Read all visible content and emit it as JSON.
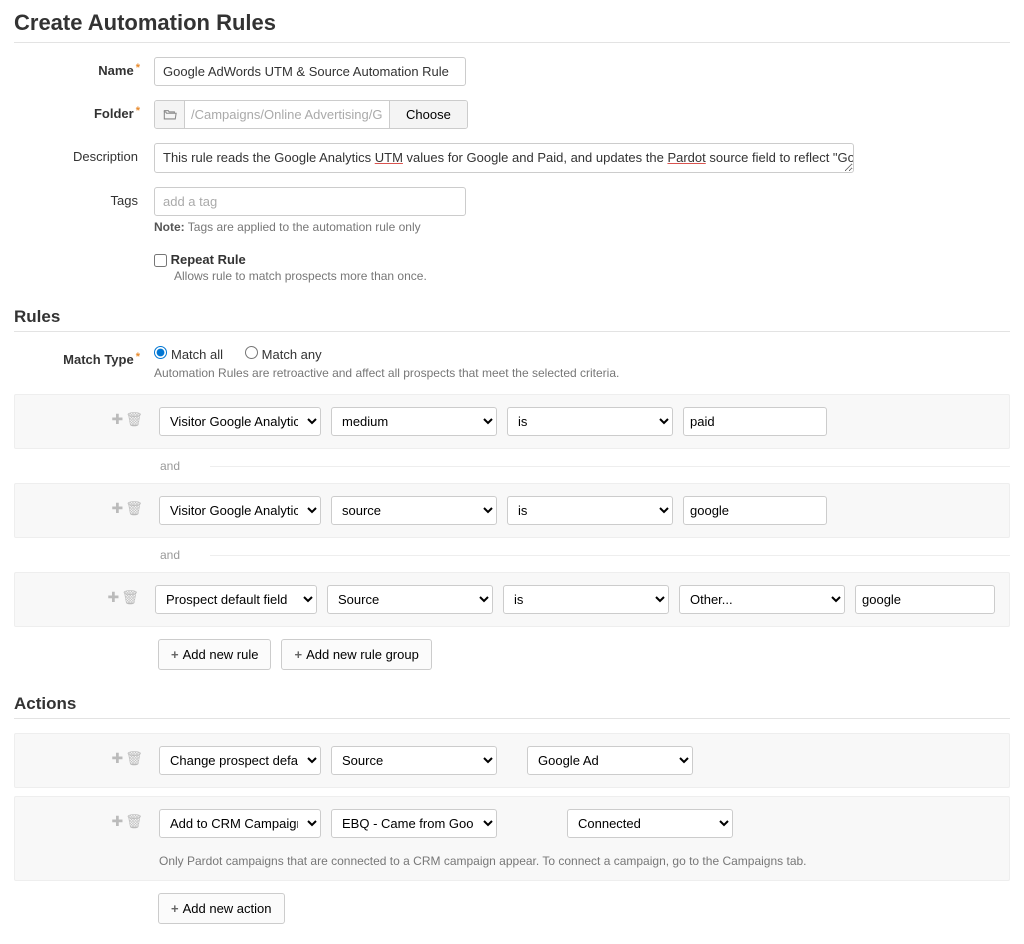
{
  "header": {
    "title": "Create Automation Rules"
  },
  "form": {
    "name_label": "Name",
    "name_value": "Google AdWords UTM & Source Automation Rule",
    "folder_label": "Folder",
    "folder_path": "/Campaigns/Online Advertising/Google Ad",
    "folder_choose": "Choose",
    "description_label": "Description",
    "description_pre": "This rule reads the Google Analytics ",
    "description_utm": "UTM",
    "description_mid": " values for Google and Paid, and updates the ",
    "description_pardot": "Pardot",
    "description_post": " source field to reflect \"Google Ads.\"",
    "tags_label": "Tags",
    "tags_placeholder": "add a tag",
    "tags_note_bold": "Note:",
    "tags_note": " Tags are applied to the automation rule only",
    "repeat_label": "Repeat Rule",
    "repeat_help": "Allows rule to match prospects more than once."
  },
  "rules": {
    "heading": "Rules",
    "match_type_label": "Match Type",
    "match_all": "Match all",
    "match_any": "Match any",
    "match_help": "Automation Rules are retroactive and affect all prospects that meet the selected criteria.",
    "connector_and": "and",
    "rows": [
      {
        "field": "Visitor Google Analytics para",
        "attr": "medium",
        "oper": "is",
        "value": "paid"
      },
      {
        "field": "Visitor Google Analytics para",
        "attr": "source",
        "oper": "is",
        "value": "google"
      },
      {
        "field": "Prospect default field",
        "attr": "Source",
        "oper": "is",
        "value_select": "Other...",
        "value2": "google"
      }
    ],
    "add_rule": "Add new rule",
    "add_group": "Add new rule group"
  },
  "actions": {
    "heading": "Actions",
    "rows": [
      {
        "field": "Change prospect default fiel",
        "attr": "Source",
        "value": "Google Ad"
      },
      {
        "field": "Add to CRM Campaign",
        "campaign": "EBQ - Came from Google Ad",
        "status": "Connected",
        "note": "Only Pardot campaigns that are connected to a CRM campaign appear. To connect a campaign, go to the Campaigns tab."
      }
    ],
    "add_action": "Add new action"
  }
}
